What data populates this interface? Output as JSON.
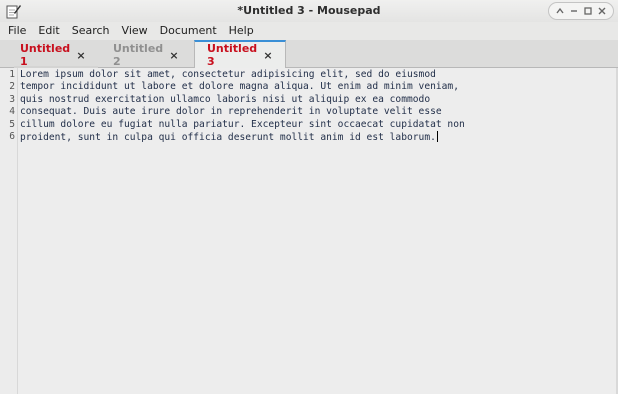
{
  "window": {
    "title": "*Untitled 3 - Mousepad",
    "app_icon": "mousepad-pencil-icon",
    "controls": [
      "minimize-up-icon",
      "restore-icon",
      "maximize-icon",
      "close-icon"
    ]
  },
  "menubar": {
    "items": [
      {
        "label": "File"
      },
      {
        "label": "Edit"
      },
      {
        "label": "Search"
      },
      {
        "label": "View"
      },
      {
        "label": "Document"
      },
      {
        "label": "Help"
      }
    ]
  },
  "tabs": [
    {
      "label": "Untitled 1",
      "close": "×",
      "active": false,
      "modified": true
    },
    {
      "label": "Untitled 2",
      "close": "×",
      "active": false,
      "modified": false
    },
    {
      "label": "Untitled 3",
      "close": "×",
      "active": true,
      "modified": true
    }
  ],
  "editor": {
    "line_numbers": [
      "1",
      "2",
      "3",
      "4",
      "5",
      "6"
    ],
    "lines": [
      "Lorem ipsum dolor sit amet, consectetur adipisicing elit, sed do eiusmod",
      "tempor incididunt ut labore et dolore magna aliqua. Ut enim ad minim veniam,",
      "quis nostrud exercitation ullamco laboris nisi ut aliquip ex ea commodo",
      "consequat. Duis aute irure dolor in reprehenderit in voluptate velit esse",
      "cillum dolore eu fugiat nulla pariatur. Excepteur sint occaecat cupidatat non",
      "proident, sunt in culpa qui officia deserunt mollit anim id est laborum."
    ]
  },
  "colors": {
    "modified_tab_text": "#c8101e",
    "inactive_tab_text": "#909090",
    "active_tab_accent": "#3a8fd6"
  }
}
